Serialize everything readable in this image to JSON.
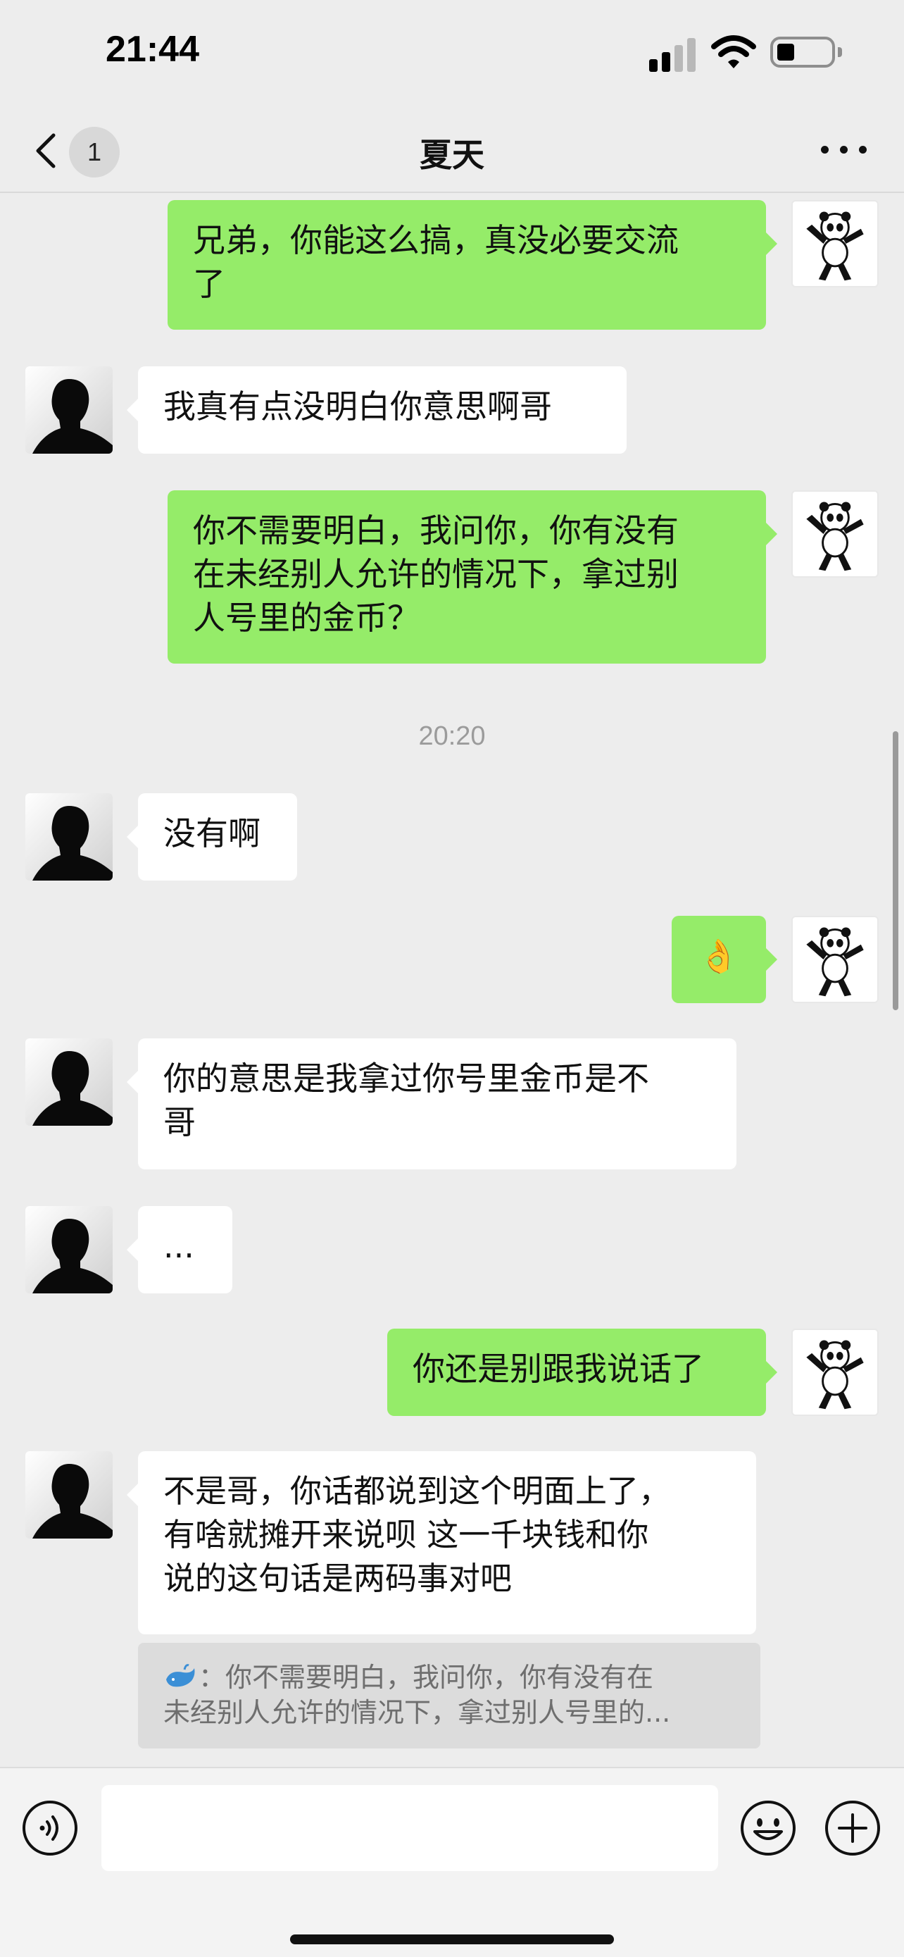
{
  "status_bar": {
    "time": "21:44"
  },
  "nav": {
    "title": "夏天",
    "unread_count": "1",
    "icons": [
      "chevron-left-icon",
      "more-dots-icon"
    ]
  },
  "messages": [
    {
      "from": "self",
      "text": "兄弟，你能这么搞，真没必要交流\n了"
    },
    {
      "from": "contact",
      "text": "我真有点没明白你意思啊哥"
    },
    {
      "from": "self",
      "text": "你不需要明白，我问你，你有没有\n在未经别人允许的情况下，拿过别\n人号里的金币？"
    },
    {
      "from": "contact",
      "text": "没有啊"
    },
    {
      "from": "self",
      "text": "👌"
    },
    {
      "from": "contact",
      "text": "你的意思是我拿过你号里金币是不\n哥"
    },
    {
      "from": "contact",
      "text": "..."
    },
    {
      "from": "self",
      "text": "你还是别跟我说话了"
    },
    {
      "from": "contact",
      "text": "不是哥，你话都说到这个明面上了，\n有啥就摊开来说呗 这一千块钱和你\n说的这句话是两码事对吧"
    }
  ],
  "timestamp": "20:20",
  "quote": {
    "text": "：你不需要明白，我问你，你有没有在\n未经别人允许的情况下，拿过别人号里的..."
  },
  "input_bar": {
    "placeholder": "",
    "icons": [
      "voice-icon",
      "emoji-icon",
      "plus-icon"
    ]
  },
  "colors": {
    "background": "#ededed",
    "self_bubble": "#95ec69",
    "contact_bubble": "#ffffff"
  }
}
